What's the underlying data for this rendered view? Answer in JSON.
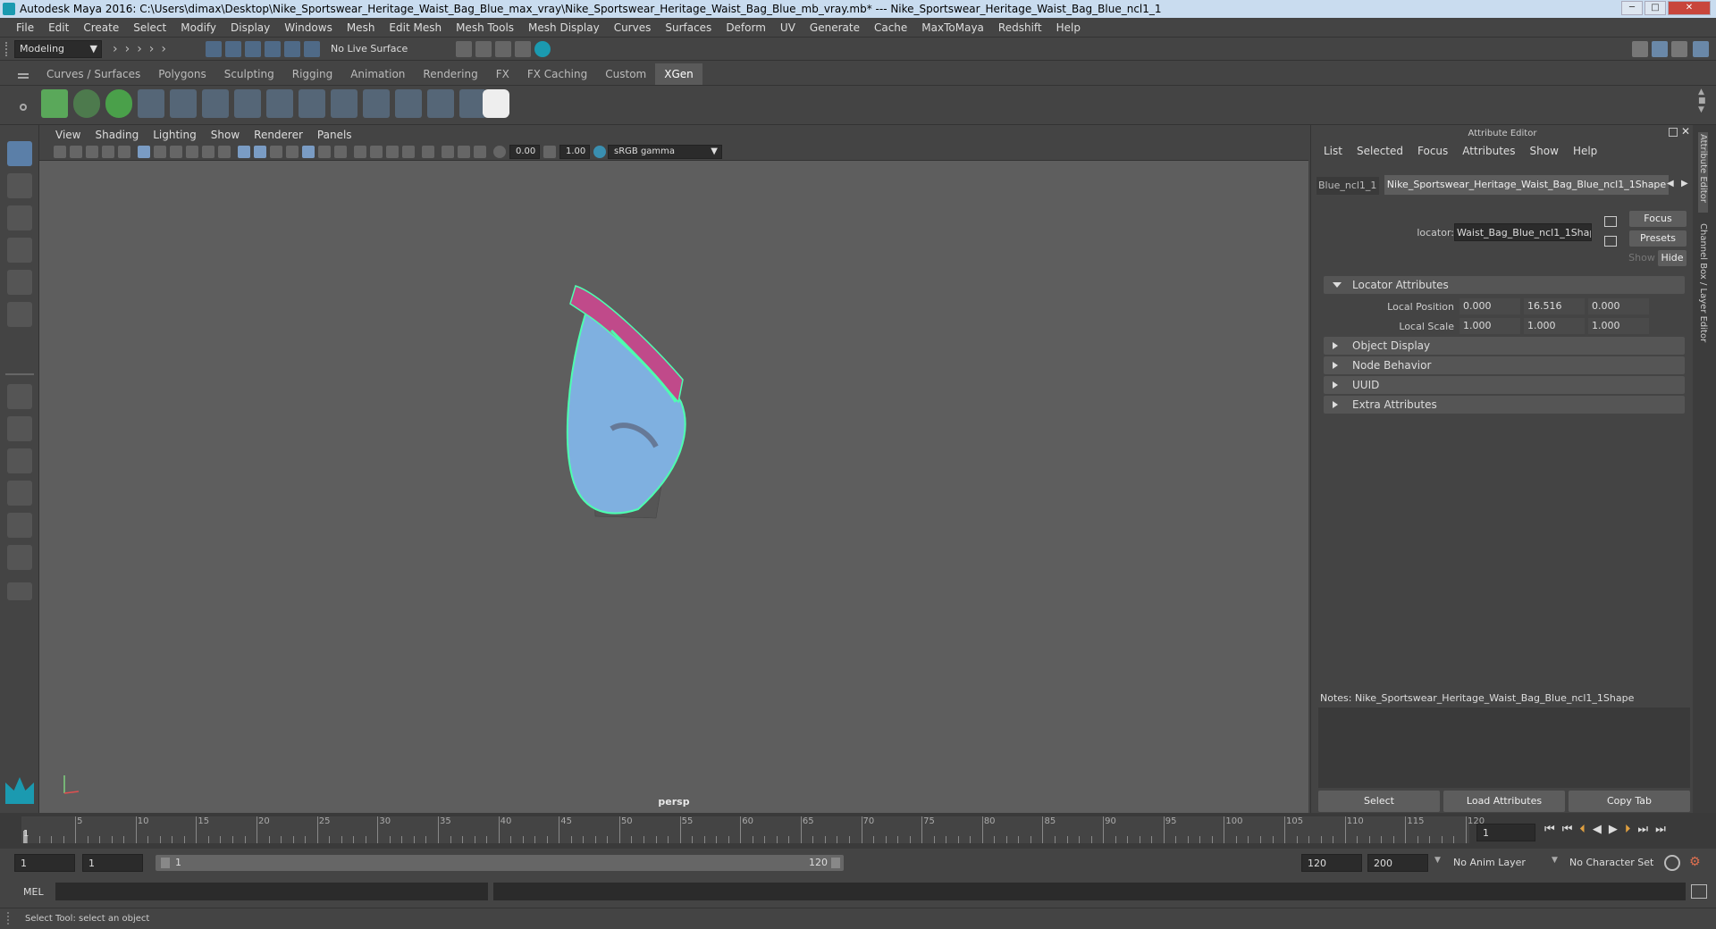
{
  "window": {
    "title": "Autodesk Maya 2016: C:\\Users\\dimax\\Desktop\\Nike_Sportswear_Heritage_Waist_Bag_Blue_max_vray\\Nike_Sportswear_Heritage_Waist_Bag_Blue_mb_vray.mb*  ---  Nike_Sportswear_Heritage_Waist_Bag_Blue_ncl1_1"
  },
  "menubar": [
    "File",
    "Edit",
    "Create",
    "Select",
    "Modify",
    "Display",
    "Windows",
    "Mesh",
    "Edit Mesh",
    "Mesh Tools",
    "Mesh Display",
    "Curves",
    "Surfaces",
    "Deform",
    "UV",
    "Generate",
    "Cache",
    "MaxToMaya",
    "Redshift",
    "Help"
  ],
  "status": {
    "mode": "Modeling",
    "live_surface": "No Live Surface"
  },
  "shelf_tabs": [
    "Curves / Surfaces",
    "Polygons",
    "Sculpting",
    "Rigging",
    "Animation",
    "Rendering",
    "FX",
    "FX Caching",
    "Custom",
    "XGen"
  ],
  "active_shelf": "XGen",
  "viewport": {
    "menu": [
      "View",
      "Shading",
      "Lighting",
      "Show",
      "Renderer",
      "Panels"
    ],
    "exposure": "0.00",
    "gamma": "1.00",
    "color_space": "sRGB gamma",
    "camera": "persp"
  },
  "attribute_editor": {
    "title": "Attribute Editor",
    "menu": [
      "List",
      "Selected",
      "Focus",
      "Attributes",
      "Show",
      "Help"
    ],
    "tabs": [
      "Blue_ncl1_1",
      "Nike_Sportswear_Heritage_Waist_Bag_Blue_ncl1_1Shape"
    ],
    "locator_label": "locator:",
    "locator_value": "Waist_Bag_Blue_ncl1_1Shape",
    "buttons": {
      "focus": "Focus",
      "presets": "Presets",
      "show": "Show",
      "hide": "Hide"
    },
    "sections": [
      "Locator Attributes",
      "Object Display",
      "Node Behavior",
      "UUID",
      "Extra Attributes"
    ],
    "local_position": {
      "label": "Local Position",
      "x": "0.000",
      "y": "16.516",
      "z": "0.000"
    },
    "local_scale": {
      "label": "Local Scale",
      "x": "1.000",
      "y": "1.000",
      "z": "1.000"
    },
    "notes": "Notes:  Nike_Sportswear_Heritage_Waist_Bag_Blue_ncl1_1Shape",
    "bottom_buttons": [
      "Select",
      "Load Attributes",
      "Copy Tab"
    ]
  },
  "side_tabs": [
    "Attribute Editor",
    "Channel Box / Layer Editor"
  ],
  "timeline": {
    "ticks": [
      "5",
      "10",
      "15",
      "20",
      "25",
      "30",
      "35",
      "40",
      "45",
      "50",
      "55",
      "60",
      "65",
      "70",
      "75",
      "80",
      "85",
      "90",
      "95",
      "100",
      "105",
      "110",
      "115",
      "120"
    ],
    "start_label": "1",
    "current_frame": "1"
  },
  "range": {
    "start": "1",
    "start2": "1",
    "range_start": "1",
    "range_end": "120",
    "end": "120",
    "end2": "200",
    "anim_layer": "No Anim Layer",
    "char_set": "No Character Set"
  },
  "cmdline": {
    "label": "MEL"
  },
  "helpline": "Select Tool: select an object"
}
